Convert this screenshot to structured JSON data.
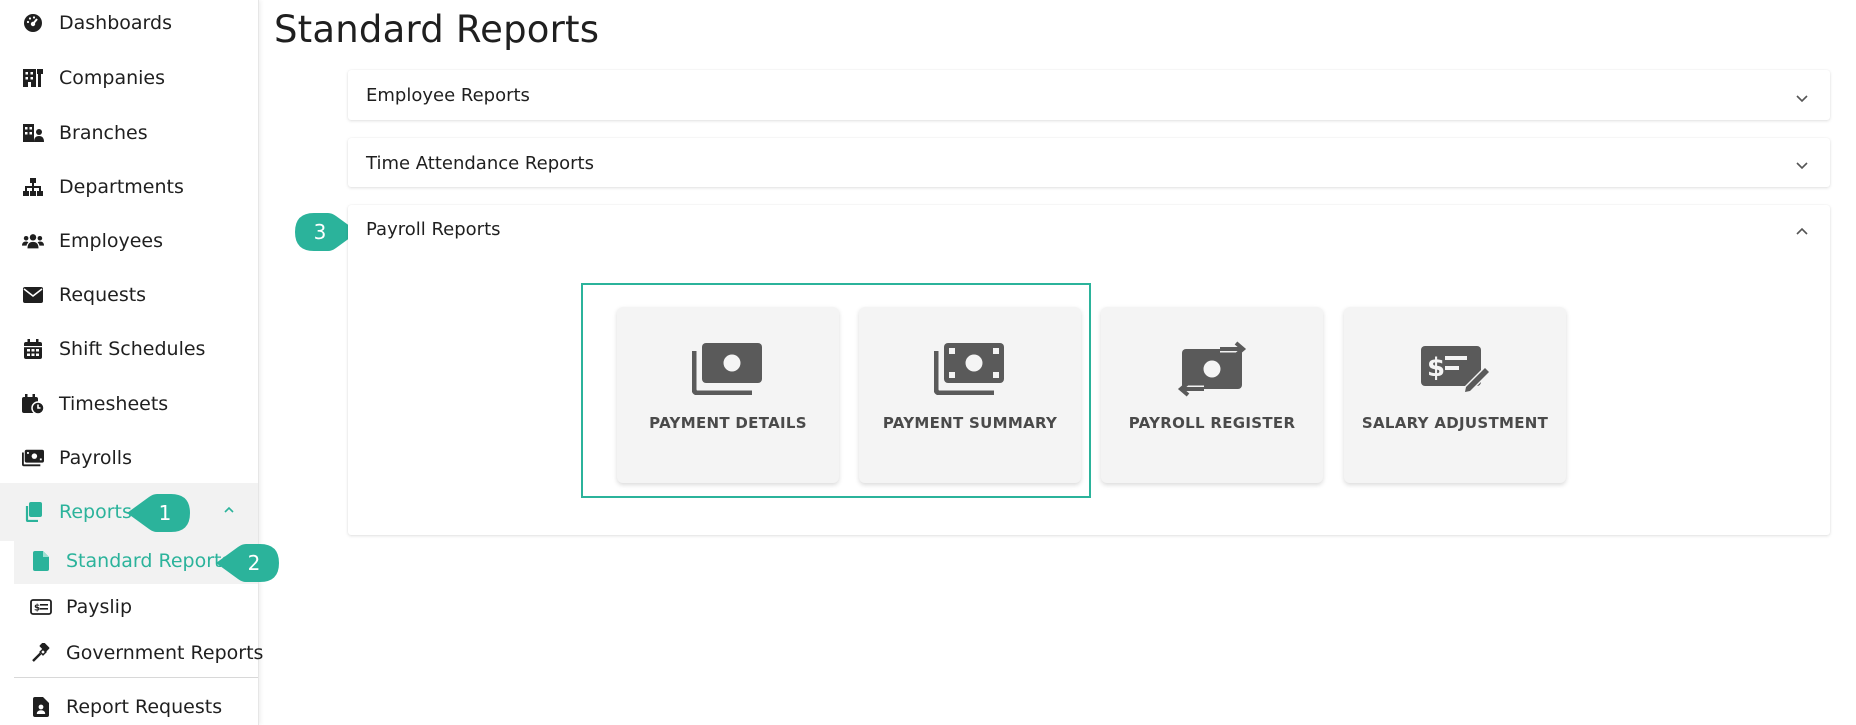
{
  "colors": {
    "accent": "#2bb39b",
    "icon_dark": "#1f1f1f",
    "tile_icon": "#5a5a5a"
  },
  "sidebar": {
    "items": [
      {
        "label": "Dashboards",
        "icon": "tachometer-icon"
      },
      {
        "label": "Companies",
        "icon": "building-icon"
      },
      {
        "label": "Branches",
        "icon": "branch-building-icon"
      },
      {
        "label": "Departments",
        "icon": "sitemap-icon"
      },
      {
        "label": "Employees",
        "icon": "users-icon"
      },
      {
        "label": "Requests",
        "icon": "envelope-icon"
      },
      {
        "label": "Shift Schedules",
        "icon": "calendar-icon"
      },
      {
        "label": "Timesheets",
        "icon": "calendar-clock-icon"
      },
      {
        "label": "Payrolls",
        "icon": "money-bill-icon"
      },
      {
        "label": "Reports",
        "icon": "copy-icon",
        "expanded": true
      }
    ],
    "sub_items": [
      {
        "label": "Standard Reports",
        "icon": "file-icon",
        "active": true
      },
      {
        "label": "Payslip",
        "icon": "money-check-icon"
      },
      {
        "label": "Government Reports",
        "icon": "gavel-icon"
      }
    ],
    "bottom_item": {
      "label": "Report Requests",
      "icon": "file-user-icon"
    }
  },
  "callouts": [
    "1",
    "2",
    "3"
  ],
  "main": {
    "title": "Standard Reports",
    "panels": [
      {
        "label": "Employee Reports",
        "expanded": false
      },
      {
        "label": "Time Attendance Reports",
        "expanded": false
      },
      {
        "label": "Payroll Reports",
        "expanded": true
      }
    ],
    "tiles": [
      {
        "label": "PAYMENT DETAILS",
        "icon": "money-bill-wave-icon"
      },
      {
        "label": "PAYMENT SUMMARY",
        "icon": "money-bills-icon"
      },
      {
        "label": "PAYROLL REGISTER",
        "icon": "money-bill-transfer-icon"
      },
      {
        "label": "SALARY ADJUSTMENT",
        "icon": "money-check-pen-icon"
      }
    ]
  }
}
